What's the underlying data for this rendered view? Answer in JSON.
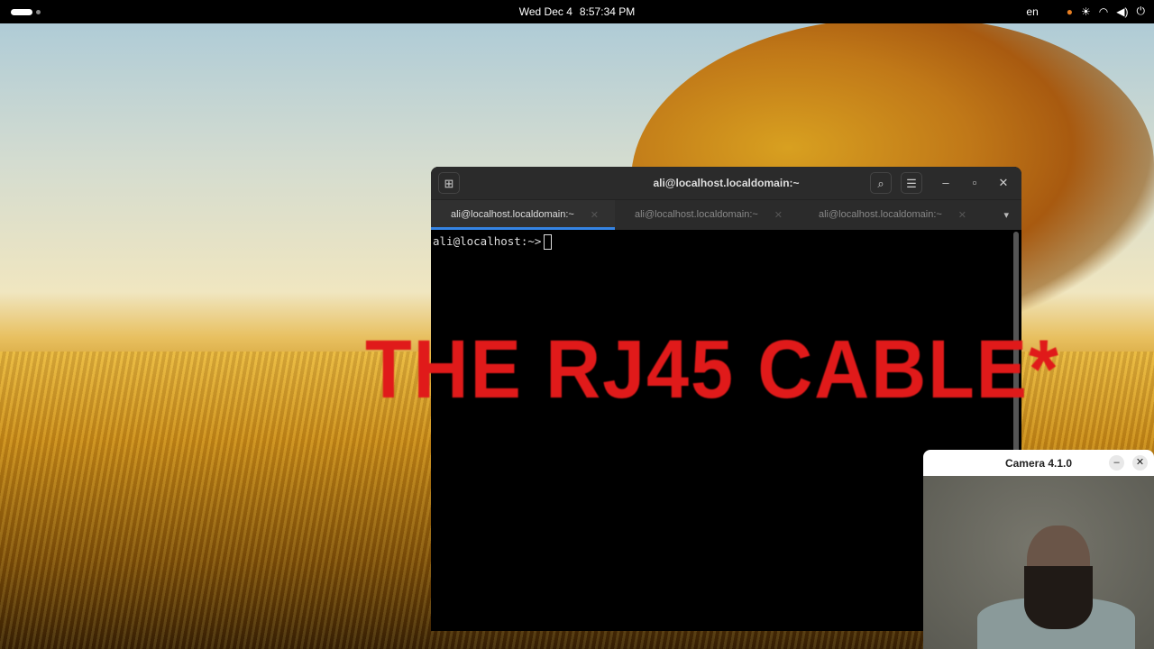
{
  "topbar": {
    "date": "Wed Dec 4",
    "time": "8:57:34 PM",
    "language": "en"
  },
  "terminal": {
    "title": "ali@localhost.localdomain:~",
    "tabs": [
      {
        "label": "ali@localhost.localdomain:~"
      },
      {
        "label": "ali@localhost.localdomain:~"
      },
      {
        "label": "ali@localhost.localdomain:~"
      }
    ],
    "prompt": "ali@localhost:~>"
  },
  "overlay": {
    "text": "THE RJ45 CABLE*"
  },
  "camera": {
    "title": "Camera 4.1.0"
  },
  "colors": {
    "accent": "#3584e4",
    "overlay": "#e01a1a"
  }
}
